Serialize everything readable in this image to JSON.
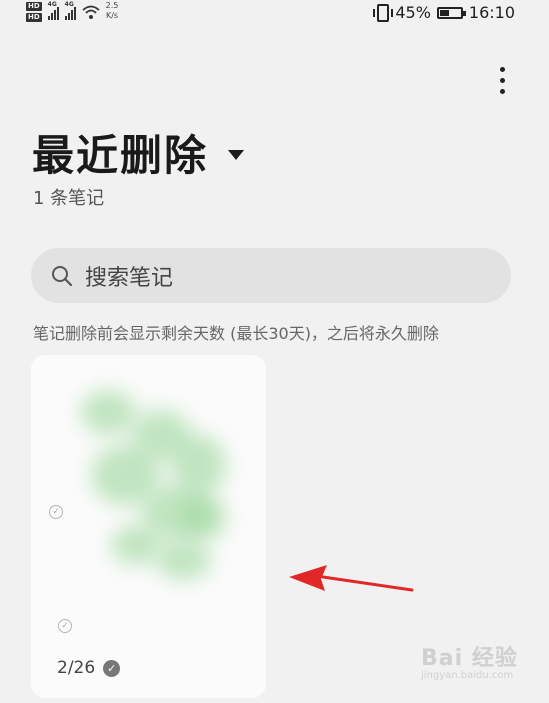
{
  "status_bar": {
    "network_label": "4G",
    "speed_value": "2.5",
    "speed_unit": "K/s",
    "battery": "45%",
    "battery_level": 0.45,
    "time": "16:10"
  },
  "header": {
    "title": "最近删除",
    "note_count": "1 条笔记"
  },
  "search": {
    "placeholder": "搜索笔记"
  },
  "info": {
    "text": "笔记删除前会显示剩余天数 (最长30天)，之后将永久删除"
  },
  "notes": [
    {
      "date": "2/26"
    }
  ],
  "colors": {
    "background": "#f1f1f1",
    "card": "#fbfbfb",
    "search_bg": "#e2e2e2",
    "arrow": "#e02828"
  },
  "watermark": {
    "main": "Bai 经验",
    "sub": "jingyan.baidu.com"
  }
}
